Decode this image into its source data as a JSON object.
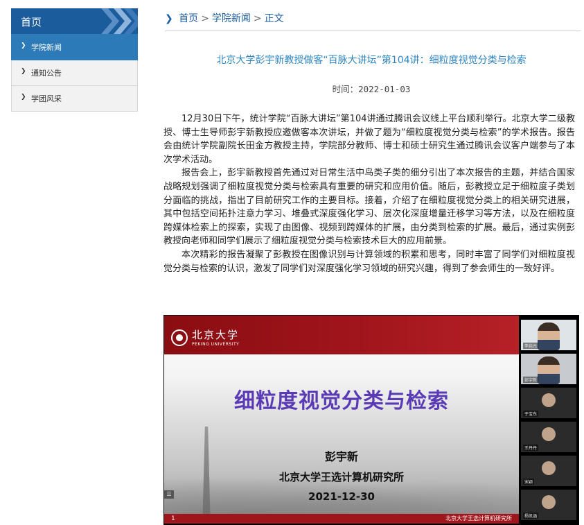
{
  "sidebar": {
    "title": "首页",
    "items": [
      {
        "label": "学院新闻",
        "active": true
      },
      {
        "label": "通知公告",
        "active": false
      },
      {
        "label": "学团风采",
        "active": false
      }
    ]
  },
  "breadcrumb": {
    "items": [
      "首页",
      "学院新闻",
      "正文"
    ],
    "separator": ">"
  },
  "article": {
    "title": "北京大学彭宇新教授做客“百脉大讲坛”第104讲：细粒度视觉分类与检索",
    "date": "时间：2022-01-03",
    "paragraphs": [
      "12月30日下午，统计学院“百脉大讲坛”第104讲通过腾讯会议线上平台顺利举行。北京大学二级教授、博士生导师彭宇新教授应邀做客本次讲坛，并做了题为“细粒度视觉分类与检索”的学术报告。报告会由统计学院副院长田金方教授主持，学院部分教师、博士和硕士研究生通过腾讯会议客户端参与了本次学术活动。",
      "报告会上，彭宇新教授首先通过对日常生活中鸟类子类的细分引出了本次报告的主题，并结合国家战略规划强调了细粒度视觉分类与检索具有重要的研究和应用价值。随后，彭教授立足于细粒度子类划分面临的挑战，指出了目前研究工作的主要目标。接着，介绍了在细粒度视觉分类上的相关研究进展，其中包括空间拓扑注意力学习、堆叠式深度强化学习、层次化深度增量迁移学习等方法，以及在细粒度跨媒体检索上的探索，实现了由图像、视频到跨媒体的扩展，由分类到检索的扩展。最后，通过实例彭教授向老师和同学们展示了细粒度视觉分类与检索技术巨大的应用前景。",
      "本次精彩的报告凝聚了彭教授在图像识别与计算领域的积累和思考，同时丰富了同学们对细粒度视觉分类与检索的认识，激发了同学们对深度强化学习领域的研究兴趣，得到了参会师生的一致好评。"
    ]
  },
  "screenshot": {
    "logo_cn": "北京大学",
    "logo_en": "PEKING UNIVERSITY",
    "slide_title": "细粒度视觉分类与检索",
    "speaker": "彭宇新",
    "org": "北京大学王选计算机研究所",
    "date": "2021-12-30",
    "page_number": "1",
    "footer_org": "北京大学王选计算机研究所",
    "menu_glyph": "☰",
    "participants": [
      "李启元",
      "彭宇新",
      "于宝东",
      "王丹丹",
      "宋颖",
      "杨凯涵"
    ]
  },
  "colors": {
    "sidebar_head": "#1b5c9c",
    "sidebar_active": "#2d7ab8",
    "title_blue": "#2e86c1",
    "slide_red": "#a0151b",
    "slide_title_purple": "#5b3bb5"
  }
}
